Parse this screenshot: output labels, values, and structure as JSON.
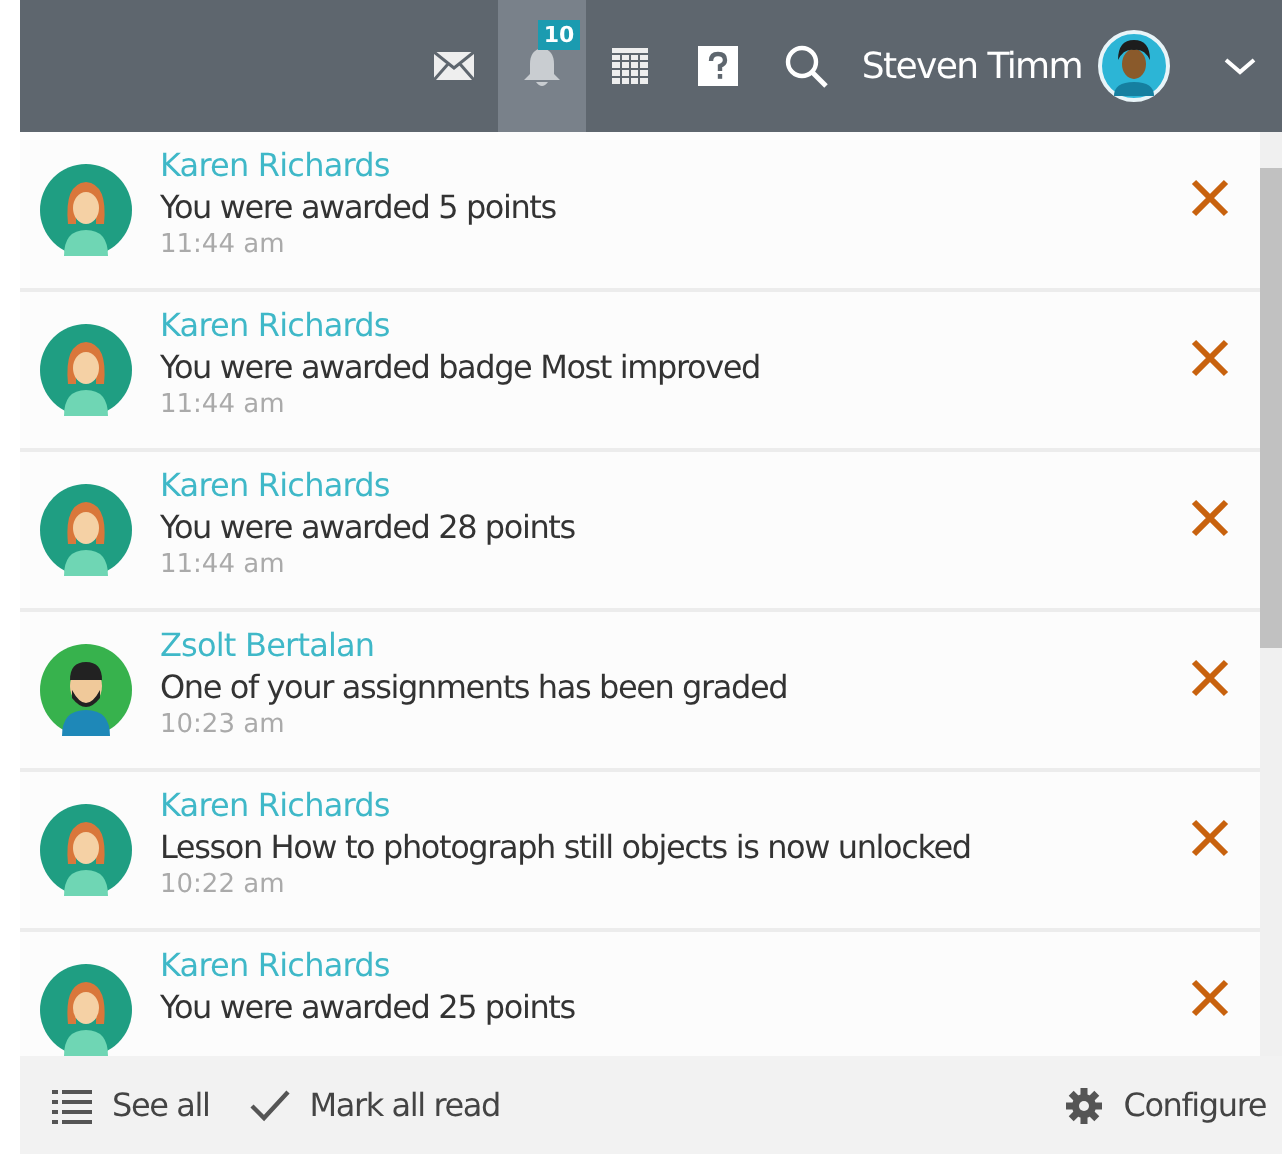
{
  "header": {
    "icons": [
      {
        "kind": "mail",
        "selected": false
      },
      {
        "kind": "notifications",
        "selected": true,
        "count": "10"
      },
      {
        "kind": "calendar",
        "selected": false
      },
      {
        "kind": "help",
        "selected": false
      },
      {
        "kind": "search",
        "selected": false
      }
    ],
    "user_name": "Steven Timm"
  },
  "notifications": [
    {
      "author": "Karen Richards",
      "kind": "female",
      "message": "You were awarded 5 points",
      "time": "11:44 am"
    },
    {
      "author": "Karen Richards",
      "kind": "female",
      "message": "You were awarded badge Most improved",
      "time": "11:44 am"
    },
    {
      "author": "Karen Richards",
      "kind": "female",
      "message": "You were awarded 28 points",
      "time": "11:44 am"
    },
    {
      "author": "Zsolt Bertalan",
      "kind": "male",
      "message": "One of your assignments has been graded",
      "time": "10:23 am"
    },
    {
      "author": "Karen Richards",
      "kind": "female",
      "message": "Lesson How to photograph still objects is now unlocked",
      "time": "10:22 am"
    },
    {
      "author": "Karen Richards",
      "kind": "female",
      "message": "You were awarded 25 points"
    }
  ],
  "footer": {
    "see_all": "See all",
    "mark_all_read": "Mark all read",
    "configure": "Configure"
  }
}
